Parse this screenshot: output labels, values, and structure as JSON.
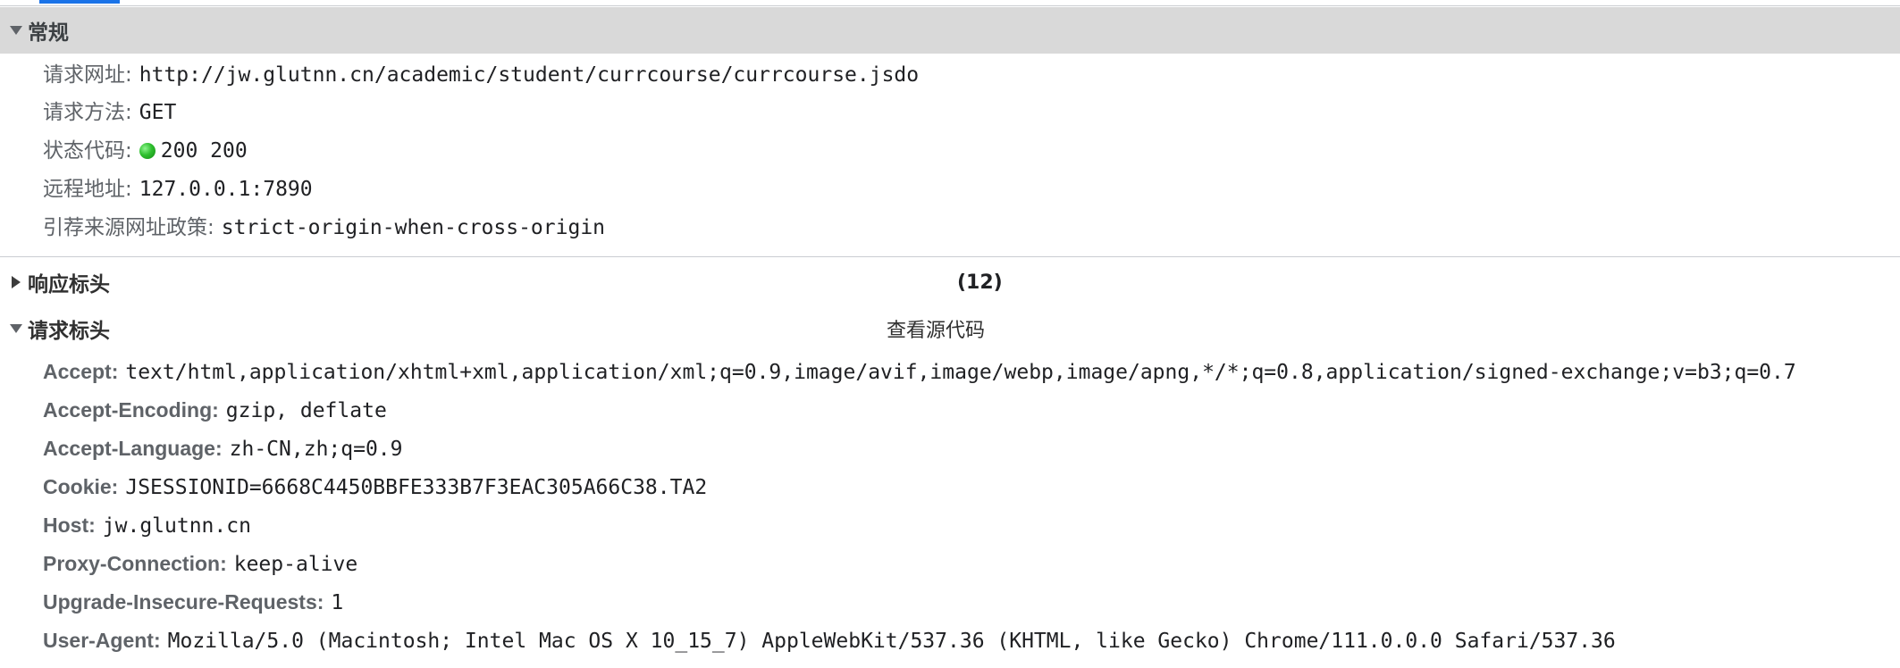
{
  "sections": {
    "general": {
      "title": "常规"
    },
    "response_headers": {
      "title": "响应标头",
      "count": "(12)"
    },
    "request_headers": {
      "title": "请求标头",
      "view_source": "查看源代码"
    }
  },
  "general": {
    "request_url": {
      "key": "请求网址:",
      "value": "http://jw.glutnn.cn/academic/student/currcourse/currcourse.jsdo"
    },
    "request_method": {
      "key": "请求方法:",
      "value": "GET"
    },
    "status_code": {
      "key": "状态代码:",
      "value": "200 200",
      "status_color": "#2fbf2f"
    },
    "remote_address": {
      "key": "远程地址:",
      "value": "127.0.0.1:7890"
    },
    "referrer_policy": {
      "key": "引荐来源网址政策:",
      "value": "strict-origin-when-cross-origin"
    }
  },
  "request_headers": {
    "accept": {
      "key": "Accept:",
      "value": "text/html,application/xhtml+xml,application/xml;q=0.9,image/avif,image/webp,image/apng,*/*;q=0.8,application/signed-exchange;v=b3;q=0.7"
    },
    "accept_encoding": {
      "key": "Accept-Encoding:",
      "value": "gzip, deflate"
    },
    "accept_language": {
      "key": "Accept-Language:",
      "value": "zh-CN,zh;q=0.9"
    },
    "cookie": {
      "key": "Cookie:",
      "value": "JSESSIONID=6668C4450BBFE333B7F3EAC305A66C38.TA2"
    },
    "host": {
      "key": "Host:",
      "value": "jw.glutnn.cn"
    },
    "proxy_connection": {
      "key": "Proxy-Connection:",
      "value": "keep-alive"
    },
    "upgrade_insecure_requests": {
      "key": "Upgrade-Insecure-Requests:",
      "value": "1"
    },
    "user_agent": {
      "key": "User-Agent:",
      "value": "Mozilla/5.0 (Macintosh; Intel Mac OS X 10_15_7) AppleWebKit/537.36 (KHTML, like Gecko) Chrome/111.0.0.0 Safari/537.36"
    }
  },
  "icons": {
    "general_toggle": "caret-down-icon",
    "response_toggle": "caret-right-icon",
    "request_toggle": "caret-down-icon",
    "status_indicator": "green-dot-icon"
  },
  "colors": {
    "section_header_bg": "#d9d9d9",
    "active_tab": "#1a73e8",
    "status_ok": "#2fbf2f"
  }
}
